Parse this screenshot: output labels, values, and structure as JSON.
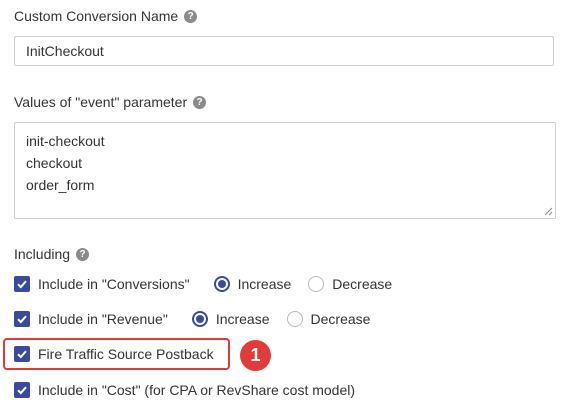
{
  "custom_conversion": {
    "label": "Custom Conversion Name",
    "value": "InitCheckout"
  },
  "event_values": {
    "label": "Values of \"event\" parameter",
    "lines": [
      "init-checkout",
      "checkout",
      "order_form"
    ]
  },
  "including": {
    "label": "Including",
    "conversions": {
      "label": "Include in \"Conversions\"",
      "checked": true,
      "increase_label": "Increase",
      "decrease_label": "Decrease",
      "selected": "Increase"
    },
    "revenue": {
      "label": "Include in \"Revenue\"",
      "checked": true,
      "increase_label": "Increase",
      "decrease_label": "Decrease",
      "selected": "Increase"
    },
    "postback": {
      "label": "Fire Traffic Source Postback",
      "checked": true
    },
    "cost": {
      "label": "Include in \"Cost\" (for CPA or RevShare cost model)",
      "checked": true
    }
  },
  "annotation": {
    "badge": "1",
    "color": "#e23b3b"
  },
  "colors": {
    "accent": "#3a4a9f",
    "help_icon": "#8a8a8a"
  },
  "help_icon_glyph": "?",
  "icons": [
    "help-icon",
    "checkbox-checked-icon",
    "radio-selected-icon",
    "radio-empty-icon",
    "resize-handle-icon"
  ]
}
